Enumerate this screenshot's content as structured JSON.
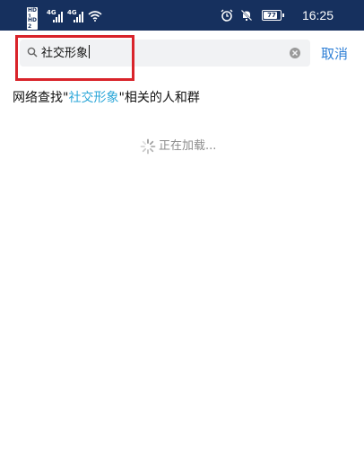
{
  "status_bar": {
    "sim1_label": "HD 1",
    "sim2_label": "HD 2",
    "network1": "4G",
    "network2": "4G",
    "battery_level": "77",
    "time": "16:25",
    "icons": [
      "signal-icon",
      "wifi-icon",
      "alarm-icon",
      "mute-icon",
      "battery-icon"
    ],
    "background_color": "#16305e"
  },
  "search": {
    "query": "社交形象",
    "cancel_label": "取消",
    "highlight_color": "#d9232a"
  },
  "results": {
    "prefix": "网络查找\"",
    "keyword": "社交形象",
    "suffix": "\"相关的人和群",
    "keyword_color": "#2aa6d8"
  },
  "loading": {
    "text": "正在加载..."
  }
}
